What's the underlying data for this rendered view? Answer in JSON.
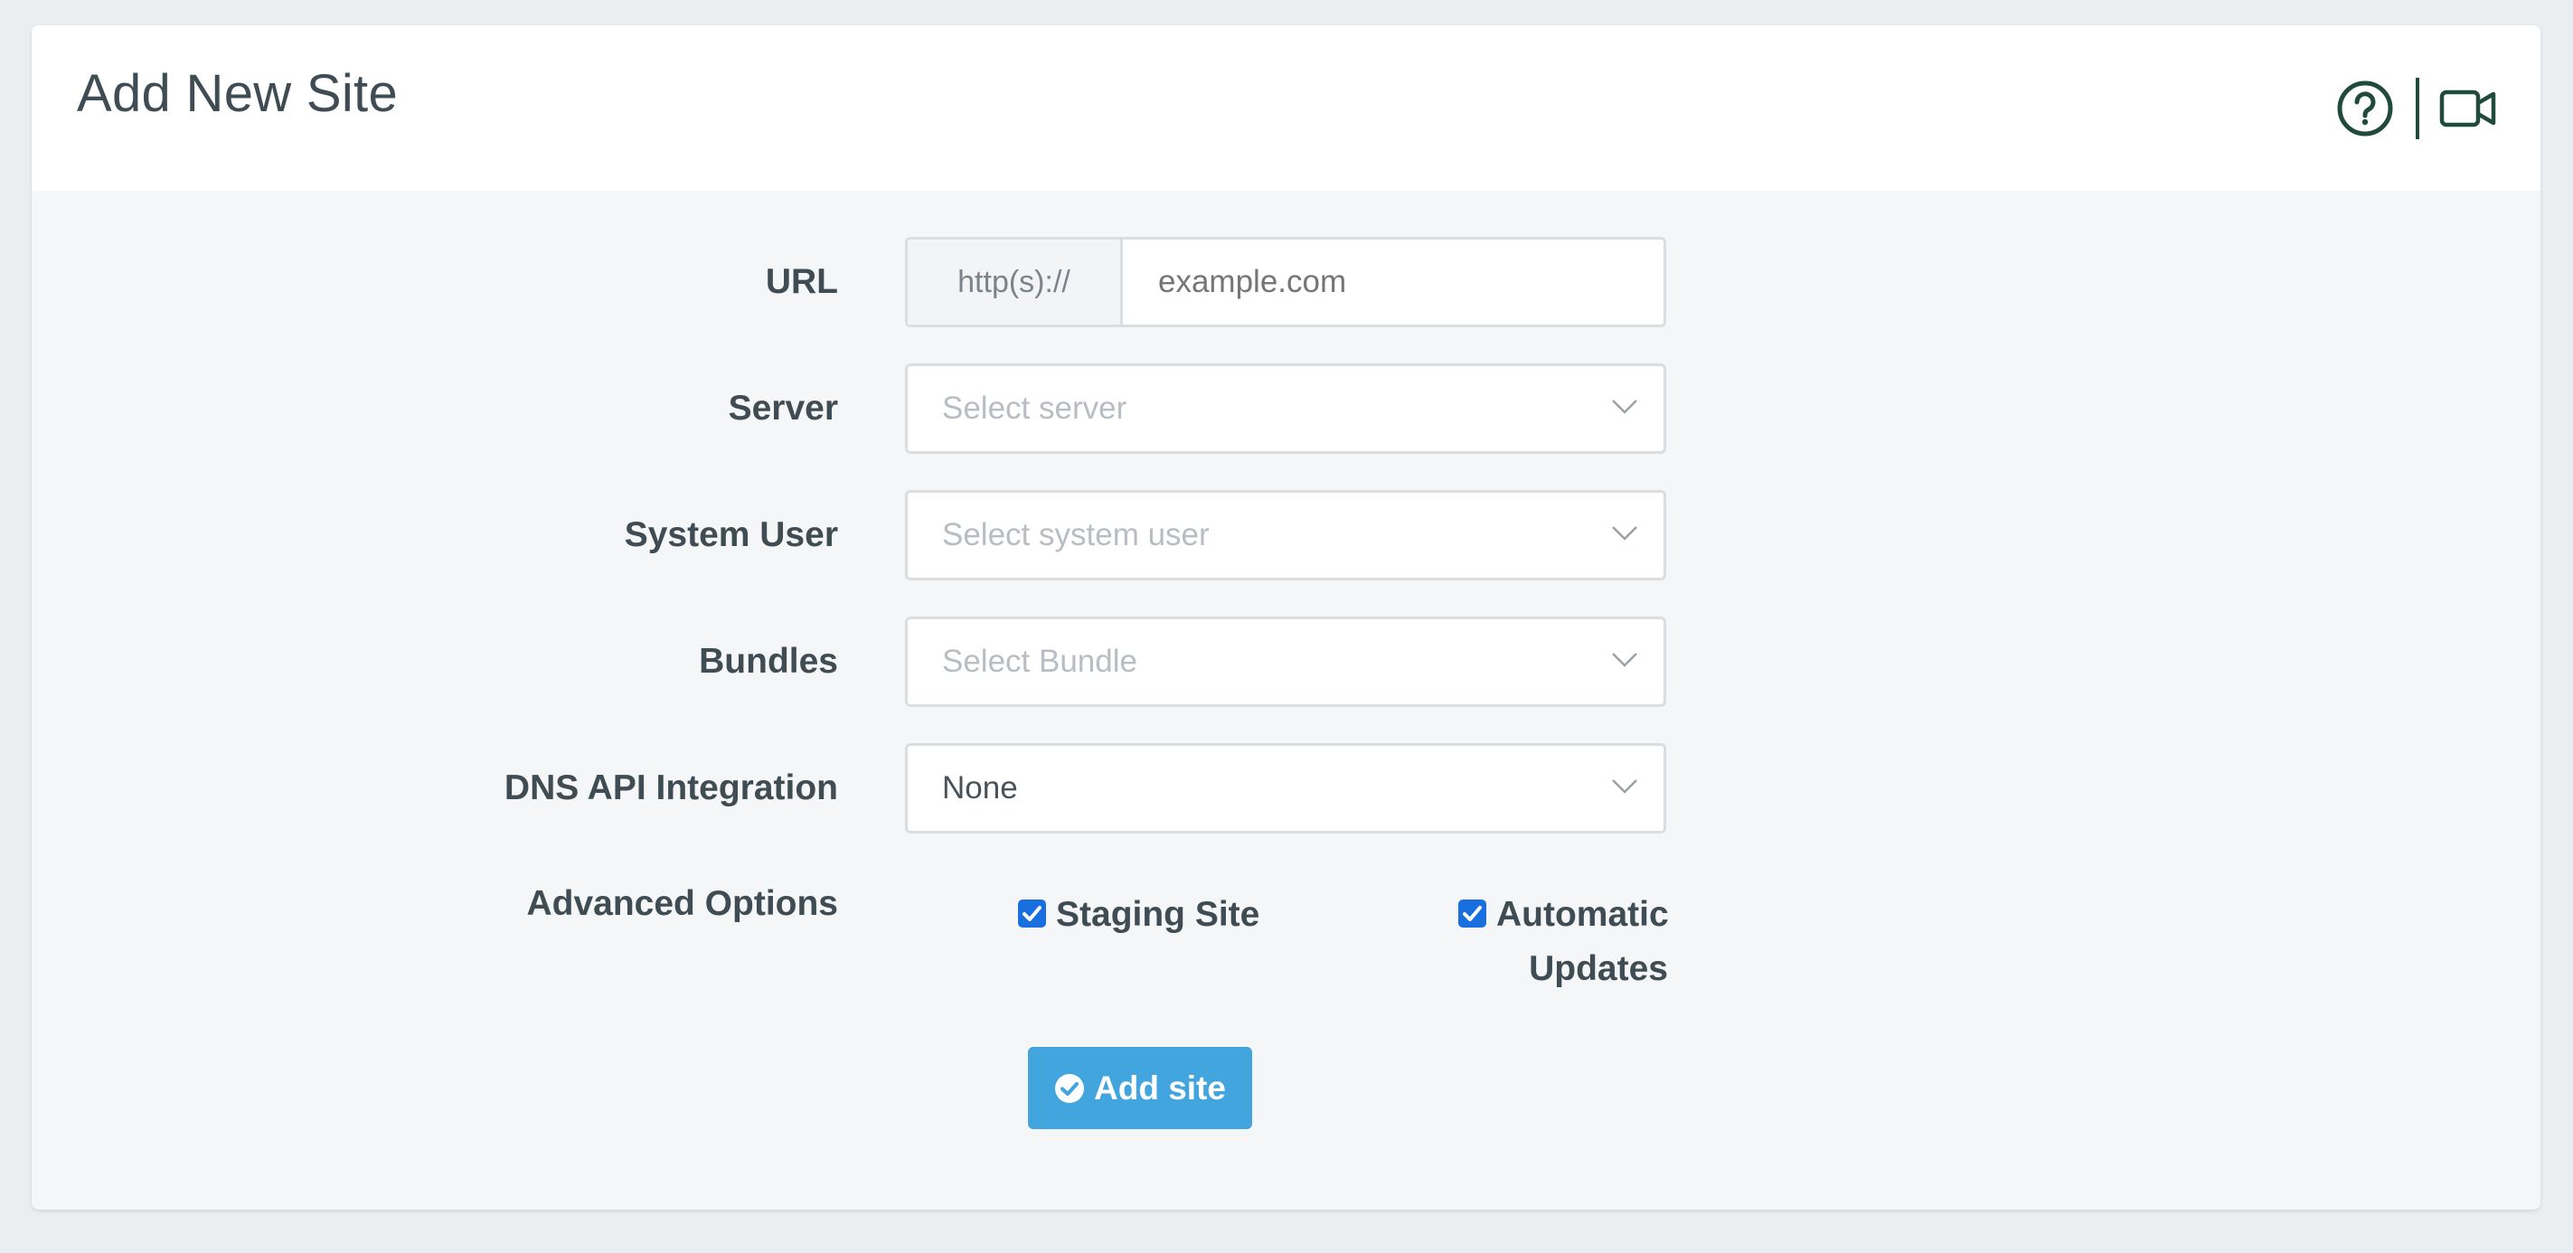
{
  "header": {
    "title": "Add New Site",
    "icons": [
      "help-circle-icon",
      "video-camera-icon"
    ]
  },
  "form": {
    "url": {
      "label": "URL",
      "prefix": "http(s)://",
      "placeholder": "example.com"
    },
    "server": {
      "label": "Server",
      "placeholder": "Select server"
    },
    "system_user": {
      "label": "System User",
      "placeholder": "Select system user"
    },
    "bundles": {
      "label": "Bundles",
      "placeholder": "Select Bundle"
    },
    "dns": {
      "label": "DNS API Integration",
      "value": "None"
    },
    "advanced": {
      "label": "Advanced Options",
      "staging": {
        "label": "Staging Site",
        "checked": true
      },
      "auto_updates": {
        "label_line1": "Automatic",
        "label_line2": "Updates",
        "checked": true
      }
    },
    "submit_label": "Add site"
  },
  "colors": {
    "accent": "#42a5de",
    "checkbox": "#1a6fe0",
    "icon": "#1f4a3c"
  }
}
